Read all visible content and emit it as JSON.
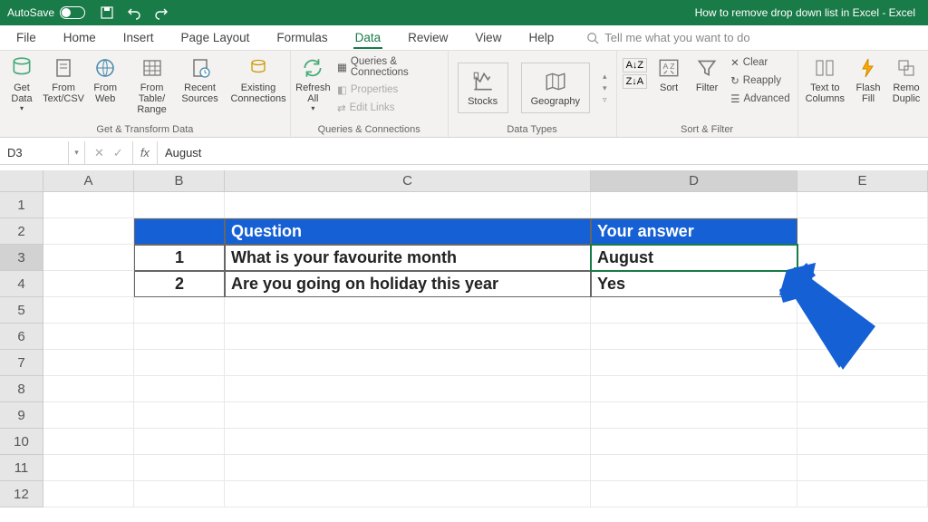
{
  "titlebar": {
    "autosave": "AutoSave",
    "toggle_state": "Off",
    "title": "How to remove drop down list in Excel - Excel"
  },
  "menu": {
    "items": [
      "File",
      "Home",
      "Insert",
      "Page Layout",
      "Formulas",
      "Data",
      "Review",
      "View",
      "Help"
    ],
    "active": "Data",
    "tellme": "Tell me what you want to do"
  },
  "ribbon": {
    "groups": [
      {
        "label": "Get & Transform Data",
        "buttons": [
          {
            "label": "Get\nData",
            "dd": true
          },
          {
            "label": "From\nText/CSV"
          },
          {
            "label": "From\nWeb"
          },
          {
            "label": "From Table/\nRange"
          },
          {
            "label": "Recent\nSources"
          },
          {
            "label": "Existing\nConnections"
          }
        ]
      },
      {
        "label": "Queries & Connections",
        "buttons": [
          {
            "label": "Refresh\nAll",
            "dd": true
          }
        ],
        "small": [
          {
            "label": "Queries & Connections"
          },
          {
            "label": "Properties",
            "disabled": true
          },
          {
            "label": "Edit Links",
            "disabled": true
          }
        ]
      },
      {
        "label": "Data Types",
        "buttons": [
          {
            "label": "Stocks"
          },
          {
            "label": "Geography"
          }
        ]
      },
      {
        "label": "Sort & Filter",
        "az": true,
        "buttons": [
          {
            "label": "Sort"
          },
          {
            "label": "Filter"
          }
        ],
        "small": [
          {
            "label": "Clear"
          },
          {
            "label": "Reapply"
          },
          {
            "label": "Advanced"
          }
        ]
      },
      {
        "label": "",
        "buttons": [
          {
            "label": "Text to\nColumns"
          },
          {
            "label": "Flash\nFill"
          },
          {
            "label": "Remo\nDuplic"
          }
        ]
      }
    ]
  },
  "formulabar": {
    "namebox": "D3",
    "value": "August"
  },
  "grid": {
    "columns": [
      "A",
      "B",
      "C",
      "D",
      "E"
    ],
    "selected_col": "D",
    "selected_row": 3,
    "rows": 12,
    "table": {
      "header_b": "",
      "header_c": "Question",
      "header_d": "Your answer",
      "data": [
        {
          "num": "1",
          "q": "What is your favourite month",
          "a": "August"
        },
        {
          "num": "2",
          "q": "Are you going on holiday this year",
          "a": "Yes"
        }
      ]
    }
  },
  "colors": {
    "accent": "#197b48",
    "table_header": "#1560d4",
    "arrow": "#1560d4"
  }
}
